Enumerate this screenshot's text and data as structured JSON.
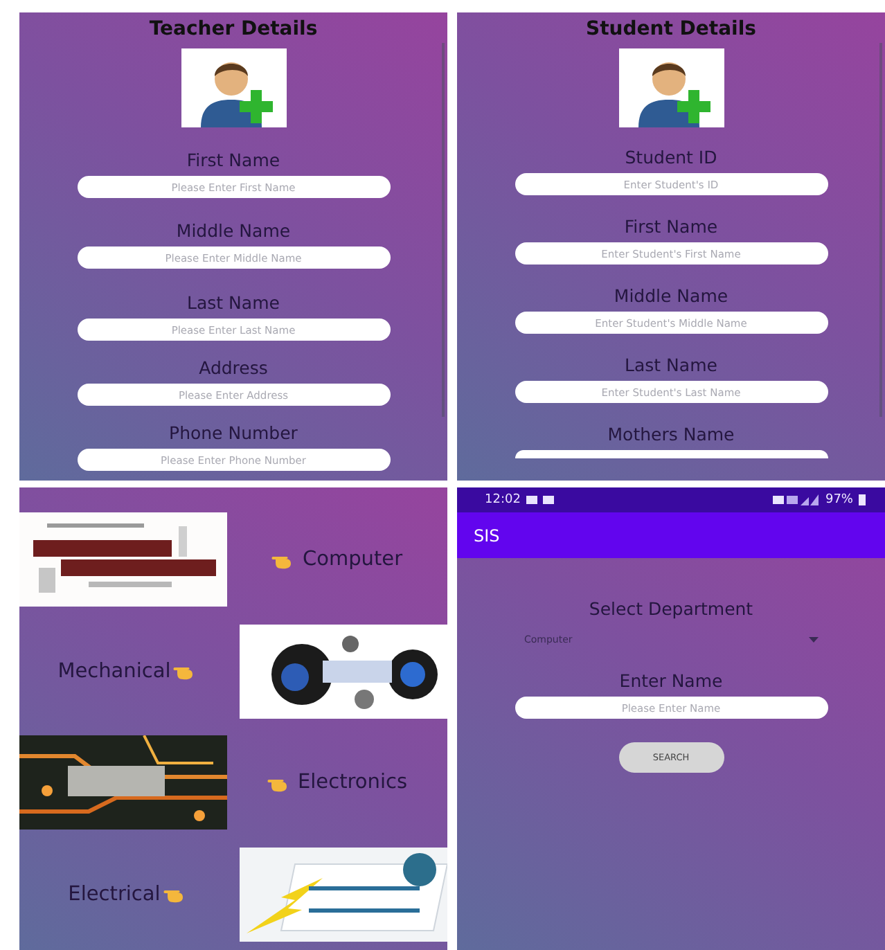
{
  "teacher_form": {
    "title": "Teacher Details",
    "fields": [
      {
        "label": "First Name",
        "placeholder": "Please Enter First Name"
      },
      {
        "label": "Middle Name",
        "placeholder": "Please Enter Middle Name"
      },
      {
        "label": "Last Name",
        "placeholder": "Please Enter Last Name"
      },
      {
        "label": "Address",
        "placeholder": "Please Enter Address"
      },
      {
        "label": "Phone Number",
        "placeholder": "Please Enter Phone Number"
      }
    ]
  },
  "student_form": {
    "title": "Student Details",
    "fields": [
      {
        "label": "Student ID",
        "placeholder": "Enter Student's ID"
      },
      {
        "label": "First Name",
        "placeholder": "Enter Student's First Name"
      },
      {
        "label": "Middle Name",
        "placeholder": "Enter Student's Middle Name"
      },
      {
        "label": "Last Name",
        "placeholder": "Enter Student's Last Name"
      },
      {
        "label": "Mothers Name"
      }
    ]
  },
  "departments": [
    {
      "name": "Computer",
      "kind": "computer"
    },
    {
      "name": "Mechanical",
      "kind": "mechanical"
    },
    {
      "name": "Electronics",
      "kind": "electronics"
    },
    {
      "name": "Electrical",
      "kind": "electrical"
    }
  ],
  "search_screen": {
    "status_bar": {
      "time": "12:02",
      "battery": "97%"
    },
    "app_bar_title": "SIS",
    "department_label": "Select Department",
    "department_value": "Computer",
    "name_label": "Enter Name",
    "name_placeholder": "Please Enter Name",
    "search_button": "SEARCH"
  }
}
